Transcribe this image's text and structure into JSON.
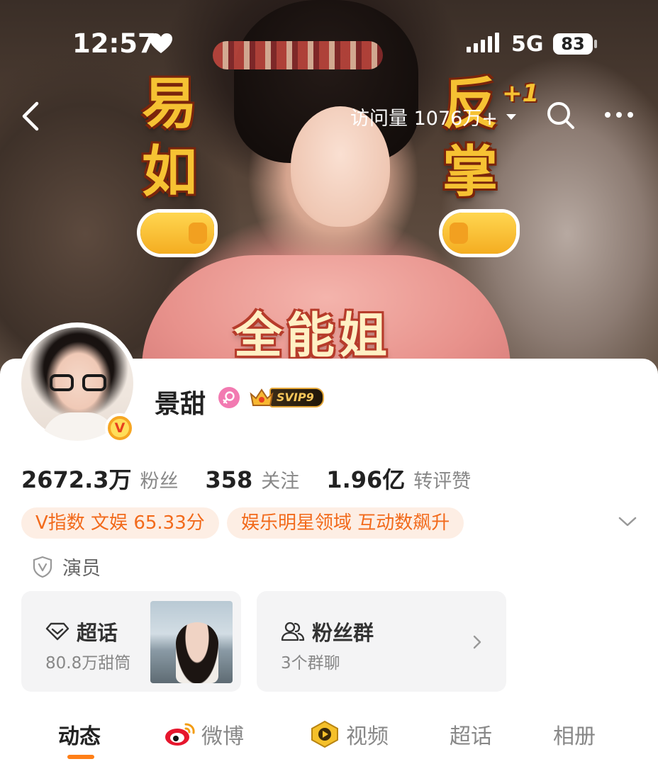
{
  "status": {
    "time": "12:57",
    "network": "5G",
    "battery": "83"
  },
  "nav": {
    "visits_label": "访问量 1076万+"
  },
  "cover": {
    "left_chars": [
      "易",
      "如"
    ],
    "right_chars": [
      "反",
      "掌"
    ],
    "plus": "+1",
    "banner": "全能姐"
  },
  "profile": {
    "name": "景甜",
    "vip_label": "SVIP9",
    "stats": [
      {
        "value": "2672.3万",
        "label": "粉丝"
      },
      {
        "value": "358",
        "label": "关注"
      },
      {
        "value": "1.96亿",
        "label": "转评赞"
      }
    ],
    "tags": [
      "V指数 文娱 65.33分",
      "娱乐明星领域 互动数飙升"
    ],
    "role": "演员"
  },
  "cards": {
    "supertopic": {
      "title": "超话",
      "sub": "80.8万甜筒"
    },
    "fangroup": {
      "title": "粉丝群",
      "sub": "3个群聊"
    }
  },
  "tabs": [
    "动态",
    "微博",
    "视频",
    "超话",
    "相册"
  ],
  "colors": {
    "accent": "#ff7f17",
    "tag_text": "#f26a1b",
    "tag_bg": "#fdeee4"
  }
}
